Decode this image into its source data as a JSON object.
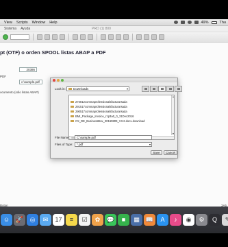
{
  "menubar": {
    "items": [
      "View",
      "Scripts",
      "Window",
      "Help"
    ],
    "status": {
      "battery": "49%",
      "day": "Thu"
    }
  },
  "sap": {
    "menu": [
      "Sistema",
      "Ayuda"
    ],
    "window_title": "PRD (1) 800",
    "page_title": "pt (OTF) o orden SPOOL listas ABAP a PDF",
    "label_pdf": "PDF",
    "spool_value": "20386",
    "pdf_filename_value": "c:\\sample.pdf",
    "doc_label": "ocumento (sólo listas ABAP)",
    "status_left": "Boton",
    "status_right": "3A5"
  },
  "dialog": {
    "lookin_label": "Look in:",
    "lookin_value": "Downloads",
    "files": [
      "274812commaprofessionalsfacturarsada",
      "291517commaprofessionalsfacturarsada",
      "290517commaprofessionalsfacturarsada",
      "BMI_Package_Invoice_r1p3a0_0_31Dec2016",
      "CX_DE_BusinessBox_20160809_V3.2.docx.download"
    ],
    "filename_label": "File Name:",
    "filename_value": "C:\\sample.pdf",
    "filetype_label": "Files of Type:",
    "filetype_value": "*.pdf",
    "save_label": "Save",
    "cancel_label": "Cancel"
  },
  "dock": {
    "apps": [
      {
        "name": "finder-icon",
        "color": "#3a8ee6",
        "glyph": "☺"
      },
      {
        "name": "launchpad-icon",
        "color": "#6b6b72",
        "glyph": "🚀"
      },
      {
        "name": "safari-icon",
        "color": "#2f7fe0",
        "glyph": "◎"
      },
      {
        "name": "mail-icon",
        "color": "#5aa9f0",
        "glyph": "✉"
      },
      {
        "name": "calendar-icon",
        "color": "#ffffff",
        "glyph": "17"
      },
      {
        "name": "notes-icon",
        "color": "#f5d84b",
        "glyph": "≡"
      },
      {
        "name": "reminders-icon",
        "color": "#f3f3f3",
        "glyph": "☑"
      },
      {
        "name": "photos-icon",
        "color": "#f0a24a",
        "glyph": "✿"
      },
      {
        "name": "messages-icon",
        "color": "#39c55a",
        "glyph": "💬"
      },
      {
        "name": "facetime-icon",
        "color": "#36b24c",
        "glyph": "■"
      },
      {
        "name": "sap-icon",
        "color": "#4a6fa8",
        "glyph": "▦"
      },
      {
        "name": "ibooks-icon",
        "color": "#f08a3a",
        "glyph": "📖"
      },
      {
        "name": "appstore-icon",
        "color": "#2a93f0",
        "glyph": "A"
      },
      {
        "name": "itunes-icon",
        "color": "#e84b8a",
        "glyph": "♪"
      },
      {
        "name": "maps-icon",
        "color": "#ffffff",
        "glyph": "◉"
      },
      {
        "name": "preferences-icon",
        "color": "#8a8a8f",
        "glyph": "⚙"
      },
      {
        "name": "quicktime-icon",
        "color": "#2d2d32",
        "glyph": "Q"
      },
      {
        "name": "unknown-app-icon",
        "color": "#d9d9d9",
        "glyph": "✎"
      }
    ]
  }
}
